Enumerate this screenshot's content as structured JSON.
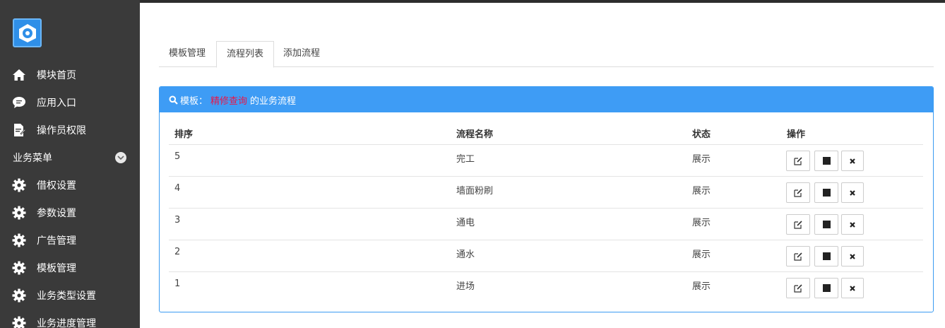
{
  "sidebar": {
    "items": [
      {
        "label": "模块首页",
        "icon": "home-icon"
      },
      {
        "label": "应用入口",
        "icon": "chat-icon"
      },
      {
        "label": "操作员权限",
        "icon": "document-edit-icon"
      }
    ],
    "section_label": "业务菜单",
    "section_items": [
      {
        "label": "借权设置",
        "icon": "gear-icon"
      },
      {
        "label": "参数设置",
        "icon": "gear-icon"
      },
      {
        "label": "广告管理",
        "icon": "gear-icon"
      },
      {
        "label": "模板管理",
        "icon": "gear-icon"
      },
      {
        "label": "业务类型设置",
        "icon": "gear-icon"
      },
      {
        "label": "业务进度管理",
        "icon": "gear-icon"
      }
    ]
  },
  "tabs": [
    {
      "label": "模板管理",
      "active": false
    },
    {
      "label": "流程列表",
      "active": true
    },
    {
      "label": "添加流程",
      "active": false
    }
  ],
  "panel": {
    "prefix": "模板：",
    "template_name": "精修查询",
    "suffix": "的业务流程",
    "accent_color": "#3e9cf5",
    "highlight_color": "#e8174a"
  },
  "table": {
    "headers": [
      "排序",
      "流程名称",
      "状态",
      "操作"
    ],
    "rows": [
      {
        "order": "5",
        "name": "完工",
        "status": "展示"
      },
      {
        "order": "4",
        "name": "墙面粉刷",
        "status": "展示"
      },
      {
        "order": "3",
        "name": "通电",
        "status": "展示"
      },
      {
        "order": "2",
        "name": "通水",
        "status": "展示"
      },
      {
        "order": "1",
        "name": "进场",
        "status": "展示"
      }
    ]
  }
}
